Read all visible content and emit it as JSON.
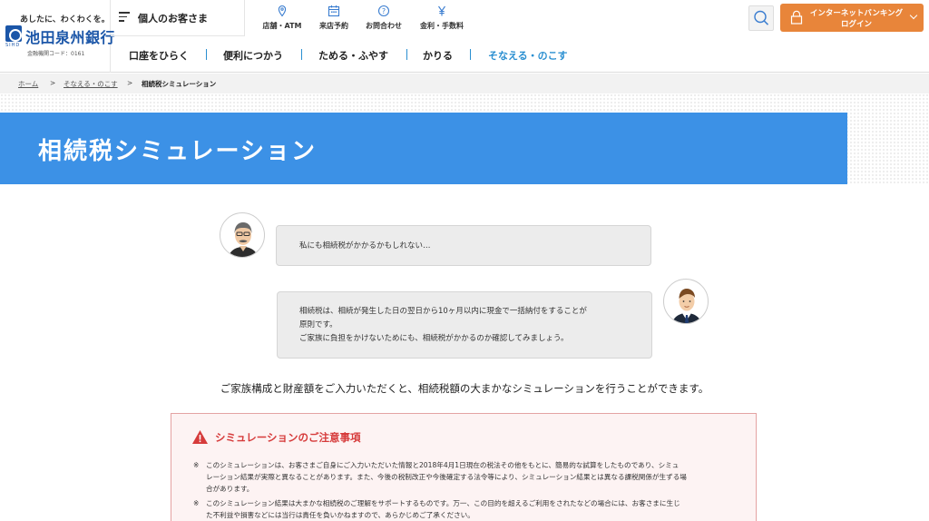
{
  "header": {
    "tagline": "あしたに、わくわくを。",
    "logo_sub": "SIHD",
    "bank_name": "池田泉州銀行",
    "bank_code": "金融機関コード：0161",
    "category": "個人のお客さま",
    "utilities": [
      {
        "label": "店舗・ATM",
        "icon": "map-pin-icon"
      },
      {
        "label": "来店予約",
        "icon": "calendar-icon"
      },
      {
        "label": "お問合わせ",
        "icon": "question-icon"
      },
      {
        "label": "金利・手数料",
        "icon": "yen-icon"
      }
    ],
    "login_line1": "インターネットバンキング",
    "login_line2": "ログイン"
  },
  "nav": {
    "items": [
      "口座をひらく",
      "便利につかう",
      "ためる・ふやす",
      "かりる",
      "そなえる・のこす"
    ],
    "active_index": 4
  },
  "breadcrumb": {
    "items": [
      "ホーム",
      "そなえる・のこす",
      "相続税シミュレーション"
    ],
    "separator": ">"
  },
  "page": {
    "title": "相続税シミュレーション",
    "bubble1": "私にも相続税がかかるかもしれない…",
    "bubble2_lines": [
      "相続税は、相続が発生した日の翌日から10ヶ月以内に現金で一括納付をすることが",
      "原則です。",
      "ご家族に負担をかけないためにも、相続税がかかるのか確認してみましょう。"
    ],
    "lead": "ご家族構成と財産額をご入力いただくと、相続税額の大まかなシミュレーションを行うことができます。"
  },
  "caution": {
    "title": "シミュレーションのご注意事項",
    "mark": "※",
    "notes": [
      [
        "このシミュレーションは、お客さまご自身にご入力いただいた情報と2018年4月1日現在の税法その他をもとに、簡易的な試算をしたものであり、シミュ",
        "レーション結果が実際と異なることがあります。また、今後の税制改正や今後確定する法令等により、シミュレーション結果とは異なる課税関係が生ずる場",
        "合があります。"
      ],
      [
        "このシミュレーション結果は大まかな相続税のご理解をサポートするものです。万一、この目的を超えるご利用をされたなどの場合には、お客さまに生じ",
        "た不利益や損害などには当行は責任を負いかねますので、あらかじめご了承ください。"
      ]
    ]
  },
  "colors": {
    "brand_blue": "#1b56a8",
    "title_band": "#3c91e6",
    "login_orange": "#e8853a",
    "caution_red": "#d63b3b"
  }
}
